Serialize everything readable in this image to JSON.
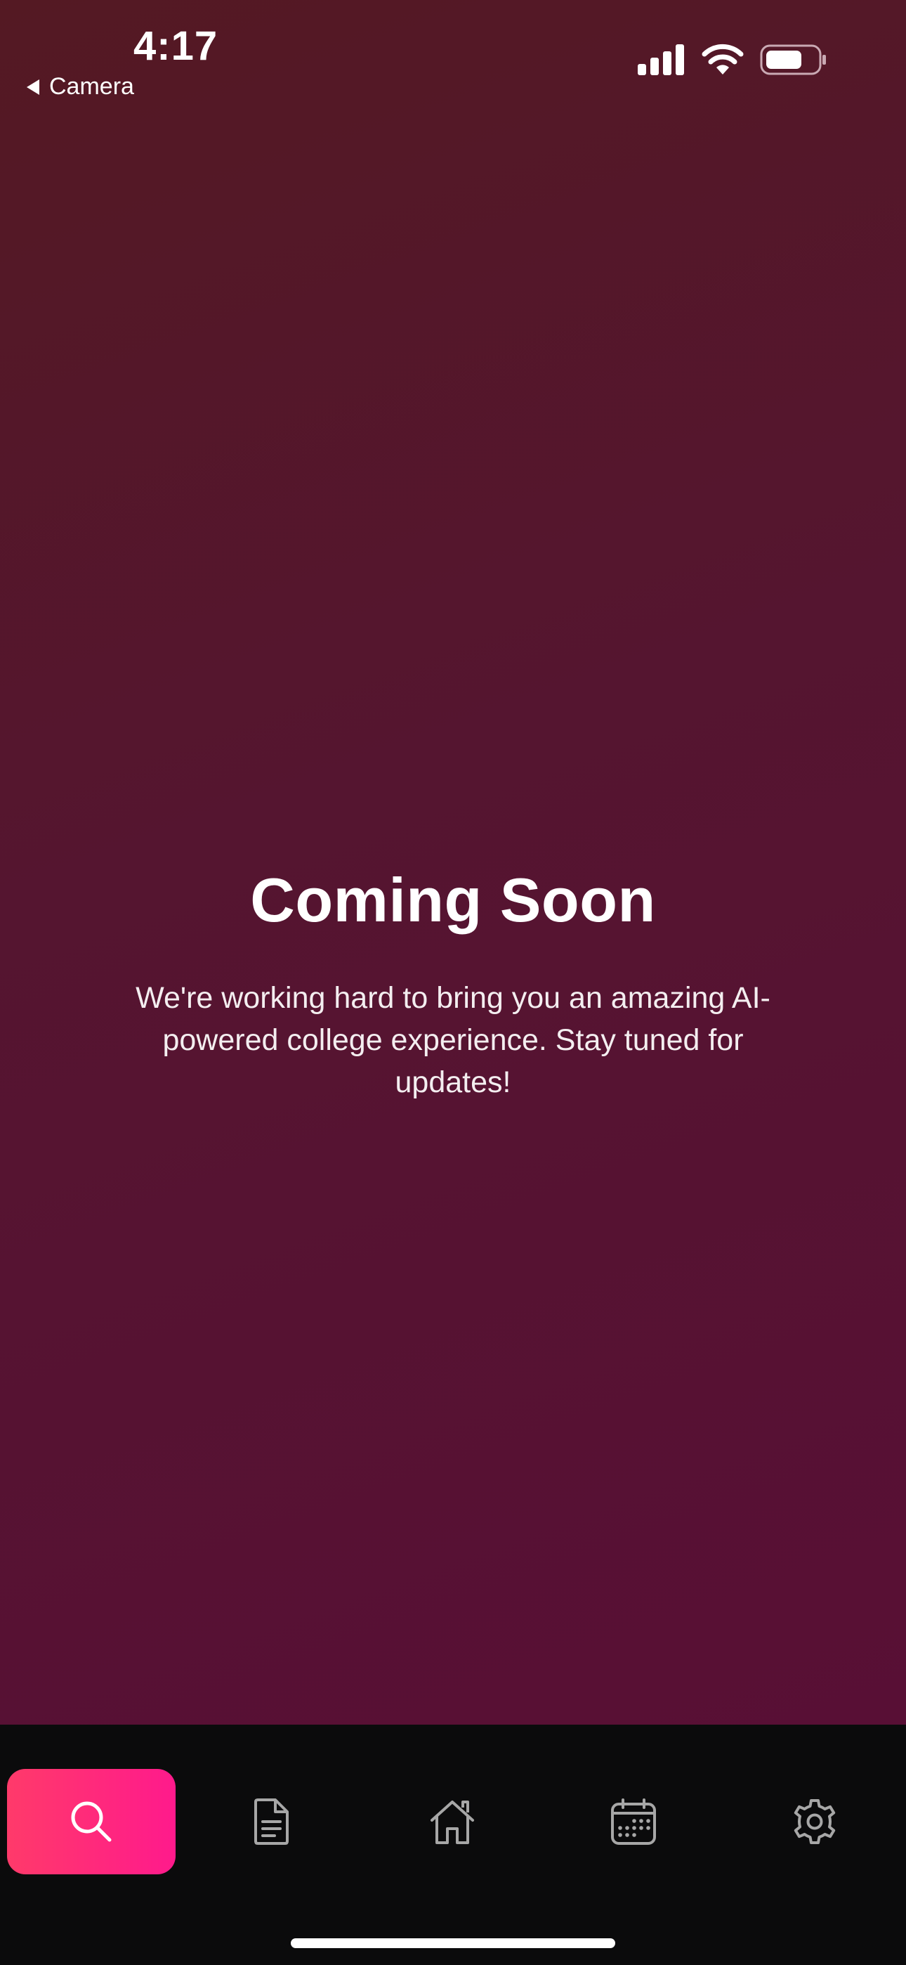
{
  "status_bar": {
    "time": "4:17",
    "back_label": "Camera",
    "icons": [
      "cellular-signal-icon",
      "wifi-icon",
      "battery-icon"
    ]
  },
  "main": {
    "title": "Coming Soon",
    "message": "We're working hard to bring you an amazing AI-powered college experience. Stay tuned for updates!"
  },
  "tab_bar": {
    "active_index": 0,
    "tabs": [
      {
        "icon": "search-icon"
      },
      {
        "icon": "document-icon"
      },
      {
        "icon": "home-icon"
      },
      {
        "icon": "calendar-icon"
      },
      {
        "icon": "gear-icon"
      }
    ]
  },
  "colors": {
    "background_top": "#541923",
    "background_bottom": "#580f35",
    "active_tab_start": "#ff3a6a",
    "active_tab_end": "#ff1a8c",
    "tab_bar": "#0b0b0c",
    "inactive_icon": "#a7a7a7"
  }
}
